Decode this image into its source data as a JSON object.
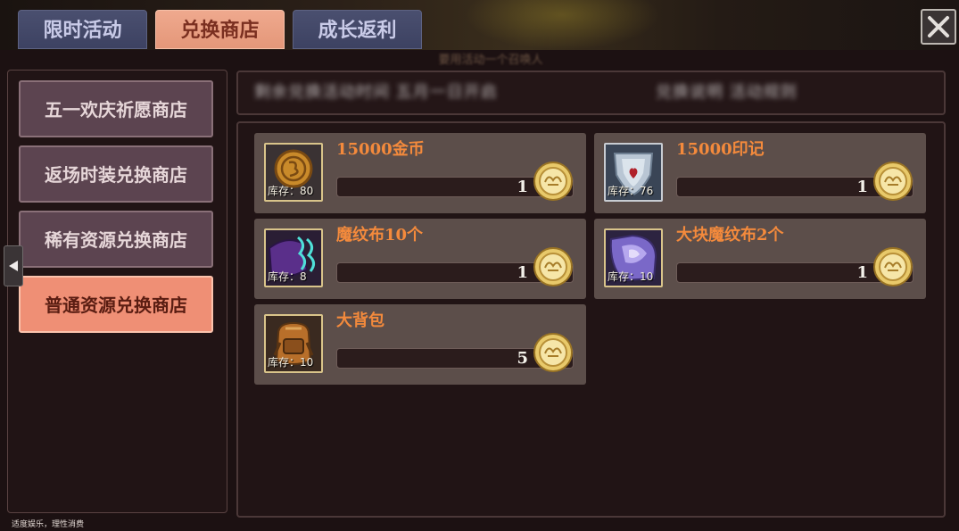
{
  "top_tabs": [
    {
      "label": "限时活动",
      "active": false
    },
    {
      "label": "兑换商店",
      "active": true
    },
    {
      "label": "成长返利",
      "active": false
    }
  ],
  "top_subtitle": "要用活动一个召唤人",
  "close_icon": "close-icon",
  "shops": [
    {
      "label": "五一欢庆祈愿商店",
      "selected": false
    },
    {
      "label": "返场时装兑换商店",
      "selected": false
    },
    {
      "label": "稀有资源兑换商店",
      "selected": false
    },
    {
      "label": "普通资源兑换商店",
      "selected": true
    }
  ],
  "header": {
    "left_text": "剩余兑换活动时间  五月一日开启",
    "right_text": "兑换说明  活动规则"
  },
  "items": [
    {
      "name": "15000金币",
      "stock": "库存：80",
      "price": "1",
      "icon": "gold-coin-icon"
    },
    {
      "name": "15000印记",
      "stock": "库存：76",
      "price": "1",
      "icon": "emblem-shield-icon"
    },
    {
      "name": "魔纹布10个",
      "stock": "库存：8",
      "price": "1",
      "icon": "magic-cloth-icon"
    },
    {
      "name": "大块魔纹布2个",
      "stock": "库存：10",
      "price": "1",
      "icon": "large-magic-cloth-icon"
    },
    {
      "name": "大背包",
      "stock": "库存：10",
      "price": "5",
      "icon": "backpack-icon"
    }
  ],
  "currency_icon": "exchange-coin-icon",
  "footer_note": "适度娱乐，理性消费",
  "colors": {
    "active_tab": "#e49779",
    "inactive_tab": "#3d4262",
    "selected_shop": "#ef8f75",
    "item_name": "#f48a3c",
    "card_bg": "#5c4e4a"
  }
}
